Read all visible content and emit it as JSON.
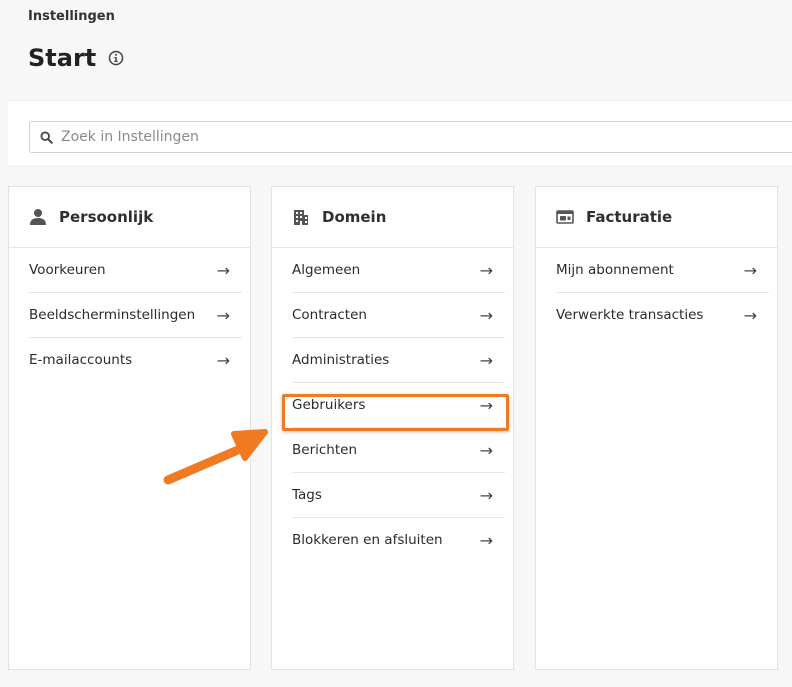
{
  "breadcrumb": "Instellingen",
  "page_title": "Start",
  "search": {
    "placeholder": "Zoek in Instellingen",
    "value": ""
  },
  "colors": {
    "highlight": "#f07a22",
    "background": "#f7f7f7",
    "icon": "#555555"
  },
  "cards": {
    "personal": {
      "title": "Persoonlijk",
      "icon": "person-icon",
      "items": [
        "Voorkeuren",
        "Beeldscherminstellingen",
        "E-mailaccounts"
      ]
    },
    "domain": {
      "title": "Domein",
      "icon": "building-icon",
      "items": [
        "Algemeen",
        "Contracten",
        "Administraties",
        "Gebruikers",
        "Berichten",
        "Tags",
        "Blokkeren en afsluiten"
      ],
      "highlighted_item": "Gebruikers"
    },
    "billing": {
      "title": "Facturatie",
      "icon": "billing-icon",
      "items": [
        "Mijn abonnement",
        "Verwerkte transacties"
      ]
    }
  },
  "arrow_glyph": "→"
}
